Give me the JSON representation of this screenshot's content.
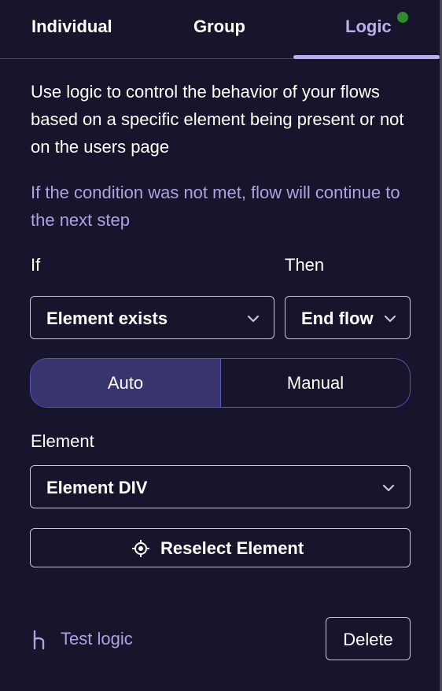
{
  "tabs": {
    "individual": "Individual",
    "group": "Group",
    "logic": "Logic",
    "active": "Logic",
    "active_color": "#b7b2ee",
    "indicator_color": "#2e8b2e"
  },
  "description": "Use logic to control the behavior of your flows based on a specific element being present or not on the users page",
  "note": "If the condition was not met, flow will continue to the next step",
  "condition": {
    "if_label": "If",
    "then_label": "Then",
    "if_value": "Element exists",
    "then_value": "End flow"
  },
  "mode": {
    "auto": "Auto",
    "manual": "Manual",
    "selected": "Auto"
  },
  "element": {
    "label": "Element",
    "value": "Element DIV"
  },
  "reselect": {
    "label": "Reselect Element",
    "icon": "crosshair-icon"
  },
  "footer": {
    "test_logic": "Test logic",
    "test_logic_icon": "branch-icon",
    "delete": "Delete"
  },
  "colors": {
    "background": "#17152b",
    "accent": "#a9a4e4",
    "segment_active": "#38356e"
  }
}
